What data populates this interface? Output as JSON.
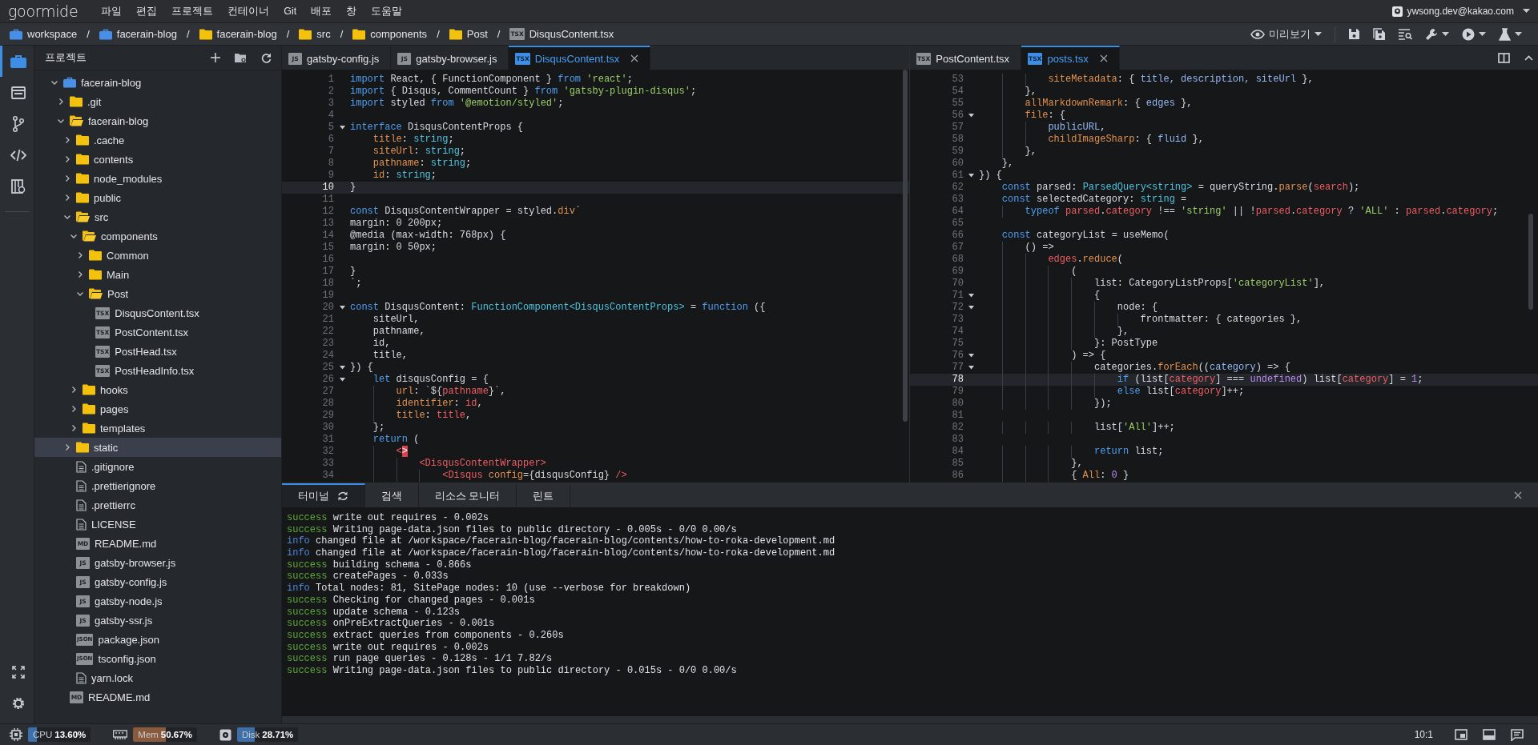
{
  "menu_bar": {
    "logo": "goormide",
    "menus": [
      "파일",
      "편집",
      "프로젝트",
      "컨테이너",
      "Git",
      "배포",
      "창",
      "도움말"
    ],
    "account": {
      "email": "ywsong.dev@kakao.com"
    }
  },
  "breadcrumb": {
    "items": [
      {
        "label": "workspace",
        "kind": "workspace"
      },
      {
        "sep": "/",
        "label": "facerain-blog",
        "kind": "workspace"
      },
      {
        "sep": "/",
        "label": "facerain-blog",
        "kind": "folder"
      },
      {
        "sep": "/",
        "label": "src",
        "kind": "folder"
      },
      {
        "sep": "/",
        "label": "components",
        "kind": "folder"
      },
      {
        "sep": "/",
        "label": "Post",
        "kind": "folder"
      },
      {
        "sep": "/",
        "label": "DisqusContent.tsx",
        "kind": "file",
        "badge": "TSX"
      }
    ]
  },
  "toolbar": {
    "preview_label": "미리보기",
    "buttons": [
      {
        "kind": "save"
      },
      {
        "kind": "save-all"
      },
      {
        "kind": "find"
      },
      {
        "kind": "wrench"
      },
      {
        "kind": "run"
      },
      {
        "kind": "flask"
      }
    ]
  },
  "activity_bar": {
    "items": [
      {
        "kind": "project",
        "selected": true
      },
      {
        "kind": "panel",
        "selected": false
      },
      {
        "kind": "git",
        "selected": false
      },
      {
        "kind": "code",
        "selected": false
      },
      {
        "kind": "book",
        "selected": false
      }
    ],
    "bottom": [
      {
        "kind": "expand"
      },
      {
        "kind": "settings"
      }
    ]
  },
  "sidebar": {
    "title": "프로젝트",
    "tree": [
      {
        "label": "facerain-blog",
        "kind": "workspace",
        "expanded": true,
        "selected": false,
        "children": [
          {
            "label": ".git",
            "kind": "folder",
            "expanded": false,
            "selected": false
          },
          {
            "label": "facerain-blog",
            "kind": "folder",
            "expanded": true,
            "selected": false,
            "children": [
              {
                "label": ".cache",
                "kind": "folder",
                "expanded": false,
                "selected": false
              },
              {
                "label": "contents",
                "kind": "folder",
                "expanded": false,
                "selected": false
              },
              {
                "label": "node_modules",
                "kind": "folder",
                "expanded": false,
                "selected": false
              },
              {
                "label": "public",
                "kind": "folder",
                "expanded": false,
                "selected": false
              },
              {
                "label": "src",
                "kind": "folder",
                "expanded": true,
                "selected": false,
                "children": [
                  {
                    "label": "components",
                    "kind": "folder",
                    "expanded": true,
                    "selected": false,
                    "children": [
                      {
                        "label": "Common",
                        "kind": "folder",
                        "expanded": false,
                        "selected": false
                      },
                      {
                        "label": "Main",
                        "kind": "folder",
                        "expanded": false,
                        "selected": false
                      },
                      {
                        "label": "Post",
                        "kind": "folder",
                        "expanded": true,
                        "selected": false,
                        "children": [
                          {
                            "label": "DisqusContent.tsx",
                            "kind": "file",
                            "badge": "TSX",
                            "selected": false
                          },
                          {
                            "label": "PostContent.tsx",
                            "kind": "file",
                            "badge": "TSX",
                            "selected": false
                          },
                          {
                            "label": "PostHead.tsx",
                            "kind": "file",
                            "badge": "TSX",
                            "selected": false
                          },
                          {
                            "label": "PostHeadInfo.tsx",
                            "kind": "file",
                            "badge": "TSX",
                            "selected": false
                          }
                        ]
                      }
                    ]
                  },
                  {
                    "label": "hooks",
                    "kind": "folder",
                    "expanded": false,
                    "selected": false
                  },
                  {
                    "label": "pages",
                    "kind": "folder",
                    "expanded": false,
                    "selected": false
                  },
                  {
                    "label": "templates",
                    "kind": "folder",
                    "expanded": false,
                    "selected": false
                  }
                ]
              },
              {
                "label": "static",
                "kind": "folder",
                "expanded": false,
                "selected": true
              },
              {
                "label": ".gitignore",
                "kind": "file",
                "selected": false
              },
              {
                "label": ".prettierignore",
                "kind": "file",
                "selected": false
              },
              {
                "label": ".prettierrc",
                "kind": "file",
                "selected": false
              },
              {
                "label": "LICENSE",
                "kind": "file",
                "selected": false
              },
              {
                "label": "README.md",
                "kind": "file",
                "badge": "MD",
                "selected": false
              },
              {
                "label": "gatsby-browser.js",
                "kind": "file",
                "badge": "JS",
                "selected": false
              },
              {
                "label": "gatsby-config.js",
                "kind": "file",
                "badge": "JS",
                "selected": false
              },
              {
                "label": "gatsby-node.js",
                "kind": "file",
                "badge": "JS",
                "selected": false
              },
              {
                "label": "gatsby-ssr.js",
                "kind": "file",
                "badge": "JS",
                "selected": false
              },
              {
                "label": "package.json",
                "kind": "file",
                "badge": "JSON",
                "selected": false
              },
              {
                "label": "tsconfig.json",
                "kind": "file",
                "badge": "JSON",
                "selected": false
              },
              {
                "label": "yarn.lock",
                "kind": "file",
                "selected": false
              }
            ]
          },
          {
            "label": "README.md",
            "kind": "file",
            "badge": "MD",
            "selected": false
          }
        ]
      }
    ]
  },
  "editors": [
    {
      "tabs": [
        {
          "label": "gatsby-config.js",
          "badge": "JS",
          "selected": false
        },
        {
          "label": "gatsby-browser.js",
          "badge": "JS",
          "selected": false
        },
        {
          "label": "DisqusContent.tsx",
          "badge": "TSX",
          "selected": true
        }
      ],
      "lines": [
        {
          "n": "1",
          "fold": false,
          "active": false,
          "tokens": [
            {
              "kind": "keyword",
              "text": "import"
            },
            {
              "kind": "plain",
              "text": " React, { FunctionComponent } "
            },
            {
              "kind": "keyword",
              "text": "from "
            },
            {
              "kind": "string",
              "text": "'react'"
            },
            {
              "kind": "plain",
              "text": ";"
            }
          ]
        },
        {
          "n": "2",
          "fold": false,
          "active": false,
          "tokens": [
            {
              "kind": "keyword",
              "text": "import"
            },
            {
              "kind": "plain",
              "text": " { Disqus, CommentCount } "
            },
            {
              "kind": "keyword",
              "text": "from "
            },
            {
              "kind": "string",
              "text": "'gatsby-plugin-disqus'"
            },
            {
              "kind": "plain",
              "text": ";"
            }
          ]
        },
        {
          "n": "3",
          "fold": false,
          "active": false,
          "tokens": [
            {
              "kind": "keyword",
              "text": "import"
            },
            {
              "kind": "plain",
              "text": " styled "
            },
            {
              "kind": "keyword",
              "text": "from "
            },
            {
              "kind": "string",
              "text": "'@emotion/styled'"
            },
            {
              "kind": "plain",
              "text": ";"
            }
          ]
        },
        {
          "n": "4",
          "fold": false,
          "active": false
        },
        {
          "n": "5",
          "fold": true,
          "active": false,
          "tokens": [
            {
              "kind": "keyword",
              "text": "interface"
            },
            {
              "kind": "plain",
              "text": " DisqusContentProps {"
            }
          ]
        },
        {
          "n": "6",
          "fold": false,
          "active": false,
          "tokens": [
            {
              "kind": "property",
              "text": "    title"
            },
            {
              "kind": "plain",
              "text": ": "
            },
            {
              "kind": "type",
              "text": "string"
            },
            {
              "kind": "plain",
              "text": ";"
            }
          ]
        },
        {
          "n": "7",
          "fold": false,
          "active": false,
          "tokens": [
            {
              "kind": "property",
              "text": "    siteUrl"
            },
            {
              "kind": "plain",
              "text": ": "
            },
            {
              "kind": "type",
              "text": "string"
            },
            {
              "kind": "plain",
              "text": ";"
            }
          ]
        },
        {
          "n": "8",
          "fold": false,
          "active": false,
          "tokens": [
            {
              "kind": "property",
              "text": "    pathname"
            },
            {
              "kind": "plain",
              "text": ": "
            },
            {
              "kind": "type",
              "text": "string"
            },
            {
              "kind": "plain",
              "text": ";"
            }
          ]
        },
        {
          "n": "9",
          "fold": false,
          "active": false,
          "tokens": [
            {
              "kind": "property",
              "text": "    id"
            },
            {
              "kind": "plain",
              "text": ": "
            },
            {
              "kind": "type",
              "text": "string"
            },
            {
              "kind": "plain",
              "text": ";"
            }
          ]
        },
        {
          "n": "10",
          "fold": false,
          "active": true,
          "tokens": [
            {
              "kind": "plain",
              "text": "}"
            }
          ]
        },
        {
          "n": "11",
          "fold": false,
          "active": false
        },
        {
          "n": "12",
          "fold": false,
          "active": false,
          "tokens": [
            {
              "kind": "keyword",
              "text": "const"
            },
            {
              "kind": "plain",
              "text": " DisqusContentWrapper = styled."
            },
            {
              "kind": "function",
              "text": "div"
            },
            {
              "kind": "plain",
              "text": "`"
            }
          ]
        },
        {
          "n": "13",
          "fold": false,
          "active": false,
          "tokens": [
            {
              "kind": "plain",
              "text": "margin: 0 200px;"
            }
          ]
        },
        {
          "n": "14",
          "fold": false,
          "active": false,
          "tokens": [
            {
              "kind": "plain",
              "text": "@media (max-width: 768px) {"
            }
          ]
        },
        {
          "n": "15",
          "fold": false,
          "active": false,
          "tokens": [
            {
              "kind": "plain",
              "text": "margin: 0 50px;"
            }
          ]
        },
        {
          "n": "16",
          "fold": false,
          "active": false
        },
        {
          "n": "17",
          "fold": false,
          "active": false,
          "tokens": [
            {
              "kind": "plain",
              "text": "}"
            }
          ]
        },
        {
          "n": "18",
          "fold": false,
          "active": false,
          "tokens": [
            {
              "kind": "plain",
              "text": "`;"
            }
          ]
        },
        {
          "n": "19",
          "fold": false,
          "active": false
        },
        {
          "n": "20",
          "fold": true,
          "active": false,
          "tokens": [
            {
              "kind": "keyword",
              "text": "const"
            },
            {
              "kind": "plain",
              "text": " DisqusContent: "
            },
            {
              "kind": "type",
              "text": "FunctionComponent<DisqusContentProps>"
            },
            {
              "kind": "plain",
              "text": " = "
            },
            {
              "kind": "keyword",
              "text": "function"
            },
            {
              "kind": "plain",
              "text": " ({"
            }
          ]
        },
        {
          "n": "21",
          "fold": false,
          "active": false,
          "tokens": [
            {
              "kind": "plain",
              "text": "    siteUrl,"
            }
          ]
        },
        {
          "n": "22",
          "fold": false,
          "active": false,
          "tokens": [
            {
              "kind": "plain",
              "text": "    pathname,"
            }
          ]
        },
        {
          "n": "23",
          "fold": false,
          "active": false,
          "tokens": [
            {
              "kind": "plain",
              "text": "    id,"
            }
          ]
        },
        {
          "n": "24",
          "fold": false,
          "active": false,
          "tokens": [
            {
              "kind": "plain",
              "text": "    title,"
            }
          ]
        },
        {
          "n": "25",
          "fold": true,
          "active": false,
          "tokens": [
            {
              "kind": "plain",
              "text": "}) {"
            }
          ]
        },
        {
          "n": "26",
          "fold": true,
          "active": false,
          "tokens": [
            {
              "kind": "keyword",
              "text": "    let"
            },
            {
              "kind": "plain",
              "text": " disqusConfig = {"
            }
          ]
        },
        {
          "n": "27",
          "fold": false,
          "active": false,
          "tokens": [
            {
              "kind": "property",
              "text": "        url"
            },
            {
              "kind": "plain",
              "text": ": `${"
            },
            {
              "kind": "variable",
              "text": "pathname"
            },
            {
              "kind": "plain",
              "text": "}`,"
            }
          ]
        },
        {
          "n": "28",
          "fold": false,
          "active": false,
          "tokens": [
            {
              "kind": "property",
              "text": "        identifier"
            },
            {
              "kind": "plain",
              "text": ": "
            },
            {
              "kind": "variable",
              "text": "id"
            },
            {
              "kind": "plain",
              "text": ","
            }
          ]
        },
        {
          "n": "29",
          "fold": false,
          "active": false,
          "tokens": [
            {
              "kind": "property",
              "text": "        title"
            },
            {
              "kind": "plain",
              "text": ": "
            },
            {
              "kind": "variable",
              "text": "title"
            },
            {
              "kind": "plain",
              "text": ","
            }
          ]
        },
        {
          "n": "30",
          "fold": false,
          "active": false,
          "tokens": [
            {
              "kind": "plain",
              "text": "    };"
            }
          ]
        },
        {
          "n": "31",
          "fold": false,
          "active": false,
          "tokens": [
            {
              "kind": "keyword",
              "text": "    return"
            },
            {
              "kind": "plain",
              "text": " ("
            }
          ]
        },
        {
          "n": "32",
          "fold": false,
          "active": false,
          "tokens": [
            {
              "kind": "variable",
              "text": "        <"
            },
            {
              "kind": "match",
              "text": ">"
            }
          ]
        },
        {
          "n": "33",
          "fold": false,
          "active": false,
          "tokens": [
            {
              "kind": "variable",
              "text": "            <DisqusContentWrapper>"
            }
          ]
        },
        {
          "n": "34",
          "fold": false,
          "active": false,
          "tokens": [
            {
              "kind": "variable",
              "text": "                <Disqus "
            },
            {
              "kind": "property",
              "text": "config"
            },
            {
              "kind": "plain",
              "text": "={disqusConfig} "
            },
            {
              "kind": "variable",
              "text": "/>"
            }
          ]
        }
      ]
    },
    {
      "tabs": [
        {
          "label": "PostContent.tsx",
          "badge": "TSX",
          "selected": false
        },
        {
          "label": "posts.tsx",
          "badge": "TSX",
          "selected": true
        }
      ],
      "lines": [
        {
          "n": "53",
          "fold": false,
          "active": false,
          "tokens": [
            {
              "kind": "property",
              "text": "            siteMetadata"
            },
            {
              "kind": "plain",
              "text": ": { "
            },
            {
              "kind": "name",
              "text": "title, description, siteUrl"
            },
            {
              "kind": "plain",
              "text": " },"
            }
          ]
        },
        {
          "n": "54",
          "fold": false,
          "active": false,
          "tokens": [
            {
              "kind": "plain",
              "text": "        },"
            }
          ]
        },
        {
          "n": "55",
          "fold": false,
          "active": false,
          "tokens": [
            {
              "kind": "property",
              "text": "        allMarkdownRemark"
            },
            {
              "kind": "plain",
              "text": ": { "
            },
            {
              "kind": "name",
              "text": "edges"
            },
            {
              "kind": "plain",
              "text": " },"
            }
          ]
        },
        {
          "n": "56",
          "fold": true,
          "active": false,
          "tokens": [
            {
              "kind": "property",
              "text": "        file"
            },
            {
              "kind": "plain",
              "text": ": {"
            }
          ]
        },
        {
          "n": "57",
          "fold": false,
          "active": false,
          "tokens": [
            {
              "kind": "name",
              "text": "            publicURL"
            },
            {
              "kind": "plain",
              "text": ","
            }
          ]
        },
        {
          "n": "58",
          "fold": false,
          "active": false,
          "tokens": [
            {
              "kind": "property",
              "text": "            childImageSharp"
            },
            {
              "kind": "plain",
              "text": ": { "
            },
            {
              "kind": "name",
              "text": "fluid"
            },
            {
              "kind": "plain",
              "text": " },"
            }
          ]
        },
        {
          "n": "59",
          "fold": false,
          "active": false,
          "tokens": [
            {
              "kind": "plain",
              "text": "        },"
            }
          ]
        },
        {
          "n": "60",
          "fold": false,
          "active": false,
          "tokens": [
            {
              "kind": "plain",
              "text": "    },"
            }
          ]
        },
        {
          "n": "61",
          "fold": true,
          "active": false,
          "tokens": [
            {
              "kind": "plain",
              "text": "}) {"
            }
          ]
        },
        {
          "n": "62",
          "fold": false,
          "active": false,
          "tokens": [
            {
              "kind": "keyword",
              "text": "    const"
            },
            {
              "kind": "plain",
              "text": " parsed: "
            },
            {
              "kind": "type",
              "text": "ParsedQuery<string>"
            },
            {
              "kind": "plain",
              "text": " = queryString."
            },
            {
              "kind": "function",
              "text": "parse"
            },
            {
              "kind": "plain",
              "text": "("
            },
            {
              "kind": "variable",
              "text": "search"
            },
            {
              "kind": "plain",
              "text": ");"
            }
          ]
        },
        {
          "n": "63",
          "fold": false,
          "active": false,
          "tokens": [
            {
              "kind": "keyword",
              "text": "    const"
            },
            {
              "kind": "plain",
              "text": " selectedCategory: "
            },
            {
              "kind": "type",
              "text": "string"
            },
            {
              "kind": "plain",
              "text": " ="
            }
          ]
        },
        {
          "n": "64",
          "fold": false,
          "active": false,
          "tokens": [
            {
              "kind": "keyword",
              "text": "        typeof "
            },
            {
              "kind": "variable",
              "text": "parsed"
            },
            {
              "kind": "plain",
              "text": "."
            },
            {
              "kind": "variable",
              "text": "category"
            },
            {
              "kind": "plain",
              "text": " !== "
            },
            {
              "kind": "string",
              "text": "'string'"
            },
            {
              "kind": "plain",
              "text": " || !"
            },
            {
              "kind": "variable",
              "text": "parsed"
            },
            {
              "kind": "plain",
              "text": "."
            },
            {
              "kind": "variable",
              "text": "category"
            },
            {
              "kind": "plain",
              "text": " ? "
            },
            {
              "kind": "string",
              "text": "'ALL'"
            },
            {
              "kind": "plain",
              "text": " : "
            },
            {
              "kind": "variable",
              "text": "parsed"
            },
            {
              "kind": "plain",
              "text": "."
            },
            {
              "kind": "variable",
              "text": "category"
            },
            {
              "kind": "plain",
              "text": ";"
            }
          ]
        },
        {
          "n": "65",
          "fold": false,
          "active": false
        },
        {
          "n": "66",
          "fold": false,
          "active": false,
          "tokens": [
            {
              "kind": "keyword",
              "text": "    const"
            },
            {
              "kind": "plain",
              "text": " categoryList = useMemo("
            }
          ]
        },
        {
          "n": "67",
          "fold": false,
          "active": false,
          "tokens": [
            {
              "kind": "plain",
              "text": "        () =>"
            }
          ]
        },
        {
          "n": "68",
          "fold": false,
          "active": false,
          "tokens": [
            {
              "kind": "variable",
              "text": "            edges"
            },
            {
              "kind": "plain",
              "text": "."
            },
            {
              "kind": "function",
              "text": "reduce"
            },
            {
              "kind": "plain",
              "text": "("
            }
          ]
        },
        {
          "n": "69",
          "fold": false,
          "active": false,
          "tokens": [
            {
              "kind": "plain",
              "text": "                ("
            }
          ]
        },
        {
          "n": "70",
          "fold": false,
          "active": false,
          "tokens": [
            {
              "kind": "plain",
              "text": "                    list: CategoryListProps["
            },
            {
              "kind": "string",
              "text": "'categoryList'"
            },
            {
              "kind": "plain",
              "text": "],"
            }
          ]
        },
        {
          "n": "71",
          "fold": true,
          "active": false,
          "tokens": [
            {
              "kind": "plain",
              "text": "                    {"
            }
          ]
        },
        {
          "n": "72",
          "fold": true,
          "active": false,
          "tokens": [
            {
              "kind": "plain",
              "text": "                        node: {"
            }
          ]
        },
        {
          "n": "73",
          "fold": false,
          "active": false,
          "tokens": [
            {
              "kind": "plain",
              "text": "                            frontmatter: { categories },"
            }
          ]
        },
        {
          "n": "74",
          "fold": false,
          "active": false,
          "tokens": [
            {
              "kind": "plain",
              "text": "                        },"
            }
          ]
        },
        {
          "n": "75",
          "fold": false,
          "active": false,
          "tokens": [
            {
              "kind": "plain",
              "text": "                    }: PostType"
            }
          ]
        },
        {
          "n": "76",
          "fold": true,
          "active": false,
          "tokens": [
            {
              "kind": "plain",
              "text": "                ) => {"
            }
          ]
        },
        {
          "n": "77",
          "fold": true,
          "active": false,
          "tokens": [
            {
              "kind": "plain",
              "text": "                    categories."
            },
            {
              "kind": "function",
              "text": "forEach"
            },
            {
              "kind": "plain",
              "text": "(("
            },
            {
              "kind": "name",
              "text": "category"
            },
            {
              "kind": "plain",
              "text": ") => {"
            }
          ]
        },
        {
          "n": "78",
          "fold": false,
          "active": true,
          "tokens": [
            {
              "kind": "keyword",
              "text": "                        if"
            },
            {
              "kind": "plain",
              "text": " (list["
            },
            {
              "kind": "variable",
              "text": "category"
            },
            {
              "kind": "plain",
              "text": "] === "
            },
            {
              "kind": "number",
              "text": "undefined"
            },
            {
              "kind": "plain",
              "text": ") list["
            },
            {
              "kind": "variable",
              "text": "category"
            },
            {
              "kind": "plain",
              "text": "] = "
            },
            {
              "kind": "number",
              "text": "1"
            },
            {
              "kind": "plain",
              "text": ";"
            }
          ]
        },
        {
          "n": "79",
          "fold": false,
          "active": false,
          "tokens": [
            {
              "kind": "keyword",
              "text": "                        else"
            },
            {
              "kind": "plain",
              "text": " list["
            },
            {
              "kind": "variable",
              "text": "category"
            },
            {
              "kind": "plain",
              "text": "]++;"
            }
          ]
        },
        {
          "n": "80",
          "fold": false,
          "active": false,
          "tokens": [
            {
              "kind": "plain",
              "text": "                    });"
            }
          ]
        },
        {
          "n": "81",
          "fold": false,
          "active": false
        },
        {
          "n": "82",
          "fold": false,
          "active": false,
          "tokens": [
            {
              "kind": "plain",
              "text": "                    list["
            },
            {
              "kind": "string",
              "text": "'All'"
            },
            {
              "kind": "plain",
              "text": "]++;"
            }
          ]
        },
        {
          "n": "83",
          "fold": false,
          "active": false
        },
        {
          "n": "84",
          "fold": false,
          "active": false,
          "tokens": [
            {
              "kind": "keyword",
              "text": "                    return"
            },
            {
              "kind": "plain",
              "text": " list;"
            }
          ]
        },
        {
          "n": "85",
          "fold": false,
          "active": false,
          "tokens": [
            {
              "kind": "plain",
              "text": "                },"
            }
          ]
        },
        {
          "n": "86",
          "fold": false,
          "active": false,
          "tokens": [
            {
              "kind": "plain",
              "text": "                { "
            },
            {
              "kind": "property",
              "text": "All"
            },
            {
              "kind": "plain",
              "text": ": "
            },
            {
              "kind": "number",
              "text": "0"
            },
            {
              "kind": "plain",
              "text": " }"
            }
          ]
        }
      ]
    }
  ],
  "panel": {
    "tabs": [
      {
        "label": "터미널",
        "selected": true
      },
      {
        "label": "검색",
        "selected": false
      },
      {
        "label": "리소스 모니터",
        "selected": false
      },
      {
        "label": "린트",
        "selected": false
      }
    ],
    "lines": [
      {
        "kind": "success",
        "tag": "success",
        "text": "write out requires - 0.002s"
      },
      {
        "kind": "success",
        "tag": "success",
        "text": "Writing page-data.json files to public directory - 0.005s - 0/0 0.00/s"
      },
      {
        "kind": "info",
        "tag": "info",
        "text": "changed file at /workspace/facerain-blog/facerain-blog/contents/how-to-roka-development.md"
      },
      {
        "kind": "info",
        "tag": "info",
        "text": "changed file at /workspace/facerain-blog/facerain-blog/contents/how-to-roka-development.md"
      },
      {
        "kind": "success",
        "tag": "success",
        "text": "building schema - 0.866s"
      },
      {
        "kind": "success",
        "tag": "success",
        "text": "createPages - 0.033s"
      },
      {
        "kind": "info",
        "tag": "info",
        "text": "Total nodes: 81, SitePage nodes: 10 (use --verbose for breakdown)"
      },
      {
        "kind": "success",
        "tag": "success",
        "text": "Checking for changed pages - 0.001s"
      },
      {
        "kind": "success",
        "tag": "success",
        "text": "update schema - 0.123s"
      },
      {
        "kind": "success",
        "tag": "success",
        "text": "onPreExtractQueries - 0.001s"
      },
      {
        "kind": "success",
        "tag": "success",
        "text": "extract queries from components - 0.260s"
      },
      {
        "kind": "success",
        "tag": "success",
        "text": "write out requires - 0.002s"
      },
      {
        "kind": "success",
        "tag": "success",
        "text": "run page queries - 0.128s - 1/1 7.82/s"
      },
      {
        "kind": "success",
        "tag": "success",
        "text": "Writing page-data.json files to public directory - 0.015s - 0/0 0.00/s"
      }
    ]
  },
  "status_bar": {
    "meters": [
      {
        "kind": "cpu",
        "label": "CPU",
        "reading": "13.60%",
        "level": 0.136,
        "color": "#3d6fa8"
      },
      {
        "kind": "memory",
        "label": "Mem",
        "reading": "50.67%",
        "level": 0.5067,
        "color": "#8a5a3c"
      },
      {
        "kind": "disk",
        "label": "Disk",
        "reading": "28.71%",
        "level": 0.2871,
        "color": "#3d6fa8"
      }
    ],
    "position": "10:1",
    "buttons": [
      {
        "kind": "window"
      },
      {
        "kind": "panel"
      },
      {
        "kind": "chat"
      }
    ]
  }
}
